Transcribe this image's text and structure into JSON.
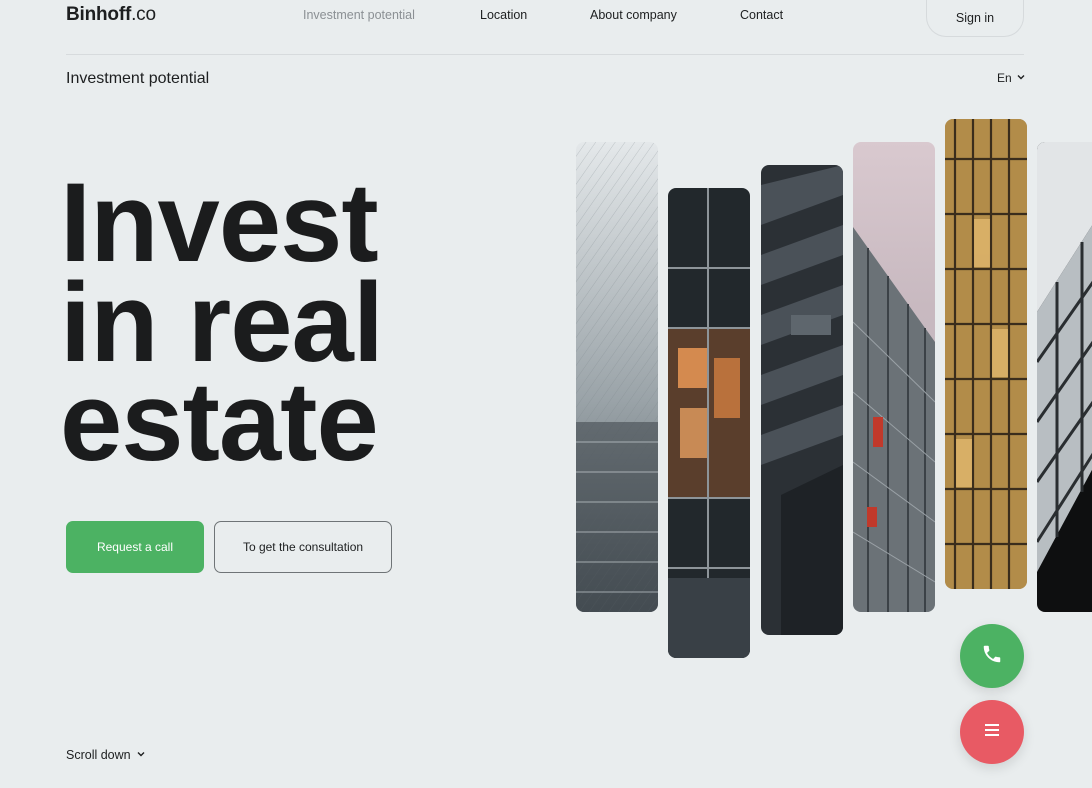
{
  "brand": {
    "name": "Binhoff",
    "tld": ".co"
  },
  "nav": {
    "items": [
      {
        "label": "Investment potential",
        "active": true
      },
      {
        "label": "Location",
        "active": false
      },
      {
        "label": "About company",
        "active": false
      },
      {
        "label": "Contact",
        "active": false
      }
    ],
    "sign_in": "Sign in"
  },
  "section": {
    "title": "Investment potential"
  },
  "language": {
    "current": "En",
    "icon": "chevron-down-icon"
  },
  "hero": {
    "lines": [
      "Invest",
      "in real",
      "estate"
    ],
    "primary_button": "Request a call",
    "secondary_button": "To get the consultation"
  },
  "scroll": {
    "label": "Scroll down",
    "icon": "chevron-down-icon"
  },
  "floating": {
    "call_icon": "phone-icon",
    "menu_icon": "menu-icon"
  },
  "colors": {
    "background": "#e9edee",
    "accent_green": "#4cb263",
    "accent_red": "#e85a64",
    "text": "#1d1f20",
    "muted": "#8b9094"
  },
  "gallery": {
    "images": [
      {
        "icon": "skyscraper-photo"
      },
      {
        "icon": "building-photo"
      },
      {
        "icon": "facade-photo"
      },
      {
        "icon": "tower-photo"
      },
      {
        "icon": "glass-building-photo"
      },
      {
        "icon": "building-corner-photo"
      }
    ]
  }
}
